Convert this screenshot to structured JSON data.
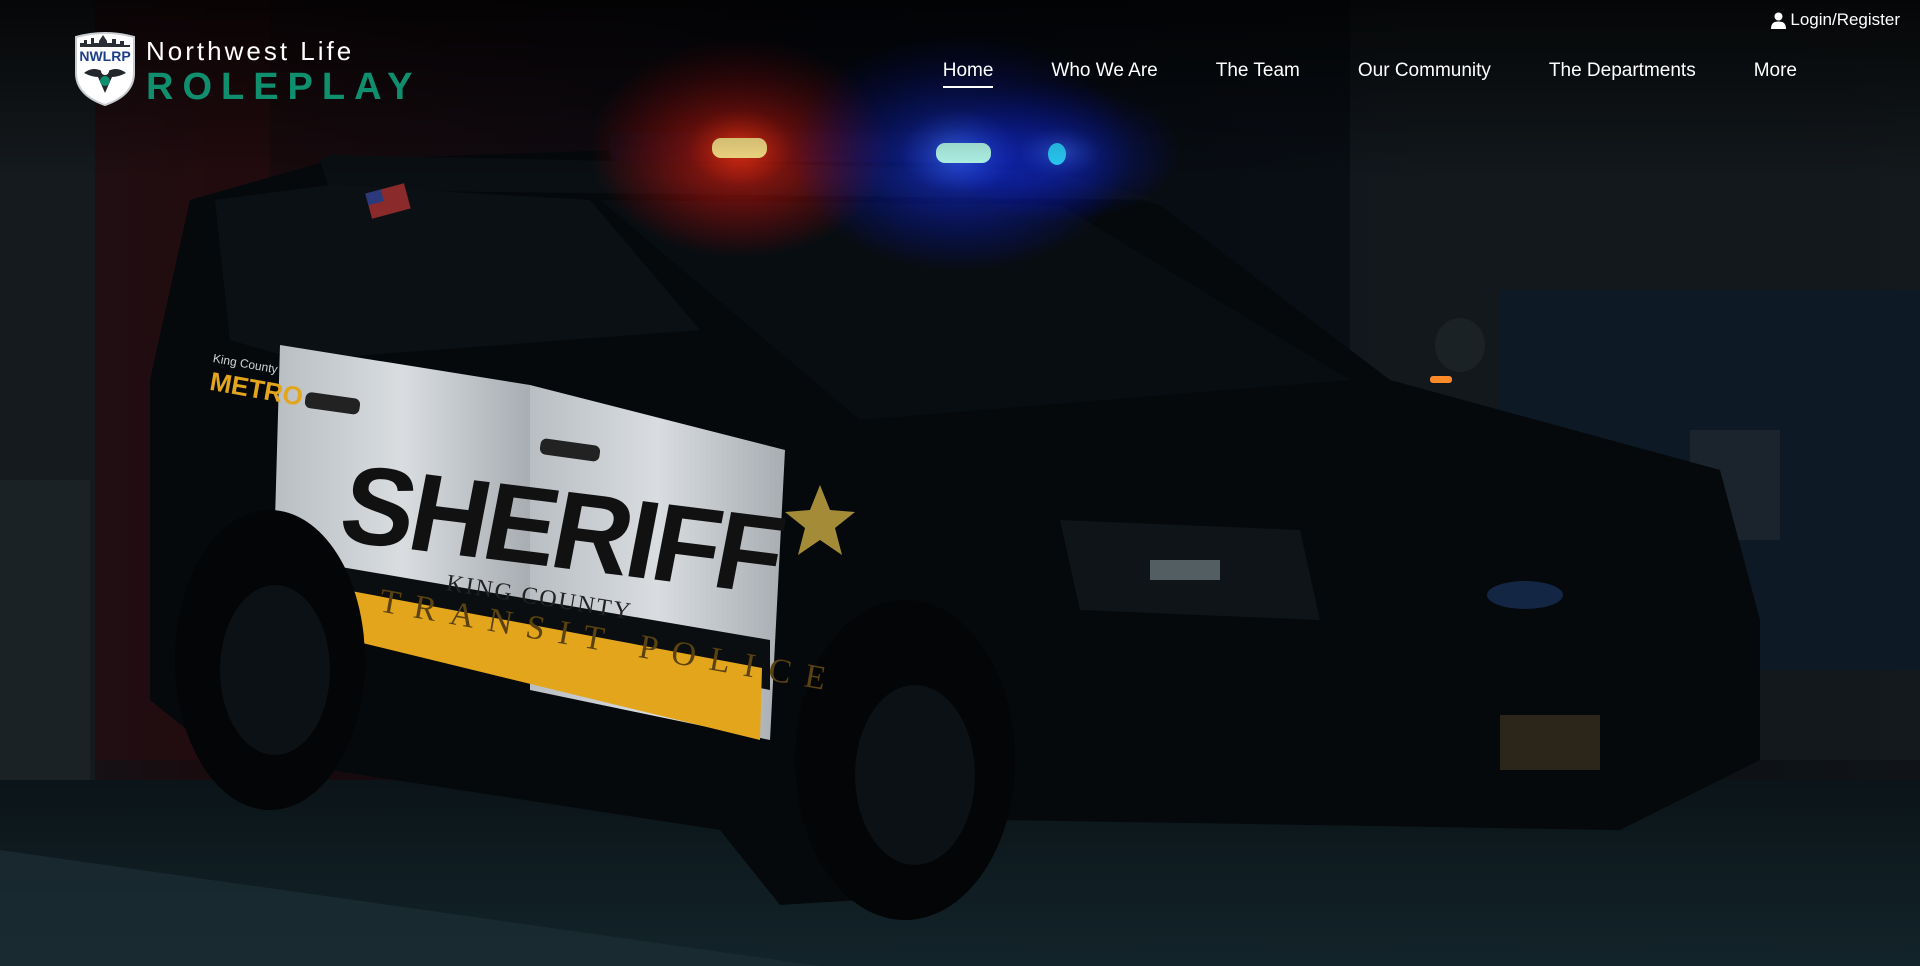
{
  "header": {
    "login_label": "Login/Register",
    "login_icon": "user-icon",
    "brand": {
      "logo_text": "NWLRP",
      "line1": "Northwest Life",
      "line2": "ROLEPLAY"
    },
    "nav": [
      {
        "label": "Home",
        "active": true
      },
      {
        "label": "Who We Are",
        "active": false
      },
      {
        "label": "The Team",
        "active": false
      },
      {
        "label": "Our Community",
        "active": false
      },
      {
        "label": "The Departments",
        "active": false
      },
      {
        "label": "More",
        "active": false
      }
    ]
  },
  "hero": {
    "vehicle_text": {
      "sheriff": "SHERIFF",
      "county": "KING COUNTY",
      "stripe": "TRANSIT POLICE",
      "agency_small": "King County",
      "agency_big": "METRO"
    },
    "colors": {
      "accent": "#0f8f6e",
      "stripe": "#e3a51c",
      "light_red": "#ff2a10",
      "light_blue": "#1a4bff"
    }
  }
}
